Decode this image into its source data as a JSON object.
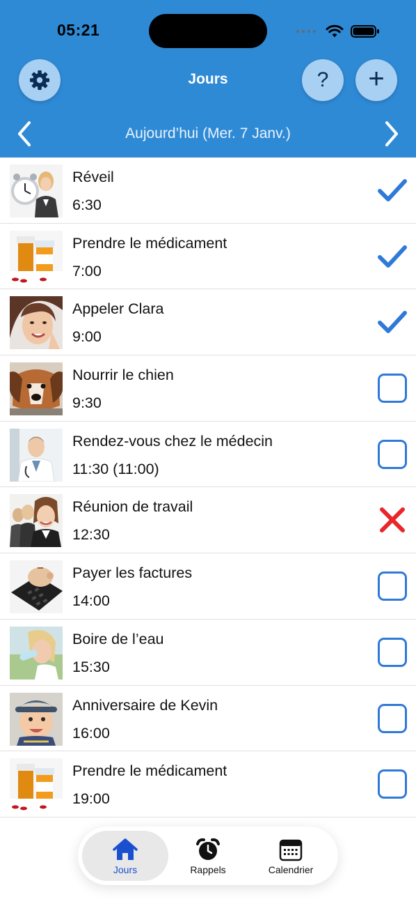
{
  "status_bar": {
    "time": "05:21"
  },
  "header": {
    "title": "Jours",
    "date_label": "Aujourd’hui (Mer. 7 Janv.)",
    "help_label": "?",
    "add_label": "+"
  },
  "colors": {
    "header_bg": "#2f8ad6",
    "check": "#2f79d8",
    "cross": "#e8272d",
    "active_tab": "#1a4fd0"
  },
  "items": [
    {
      "title": "Réveil",
      "time": "6:30",
      "status": "done",
      "image": "alarm-clock-woman"
    },
    {
      "title": "Prendre le médicament",
      "time": "7:00",
      "status": "done",
      "image": "medicine-bottles"
    },
    {
      "title": "Appeler Clara",
      "time": "9:00",
      "status": "done",
      "image": "smiling-woman"
    },
    {
      "title": "Nourrir le chien",
      "time": "9:30",
      "status": "pending",
      "image": "dog"
    },
    {
      "title": "Rendez-vous chez le médecin",
      "time": "11:30 (11:00)",
      "status": "pending",
      "image": "doctor"
    },
    {
      "title": "Réunion de travail",
      "time": "12:30",
      "status": "missed",
      "image": "business-women"
    },
    {
      "title": "Payer les factures",
      "time": "14:00",
      "status": "pending",
      "image": "piggy-bank-calculator"
    },
    {
      "title": "Boire de l’eau",
      "time": "15:30",
      "status": "pending",
      "image": "woman-drinking"
    },
    {
      "title": "Anniversaire de Kevin",
      "time": "16:00",
      "status": "pending",
      "image": "baby-boy"
    },
    {
      "title": "Prendre le médicament",
      "time": "19:00",
      "status": "pending",
      "image": "medicine-bottles"
    }
  ],
  "tabbar": {
    "tabs": [
      {
        "label": "Jours",
        "icon": "home-icon",
        "active": true
      },
      {
        "label": "Rappels",
        "icon": "alarm-clock-icon",
        "active": false
      },
      {
        "label": "Calendrier",
        "icon": "calendar-icon",
        "active": false
      }
    ]
  }
}
